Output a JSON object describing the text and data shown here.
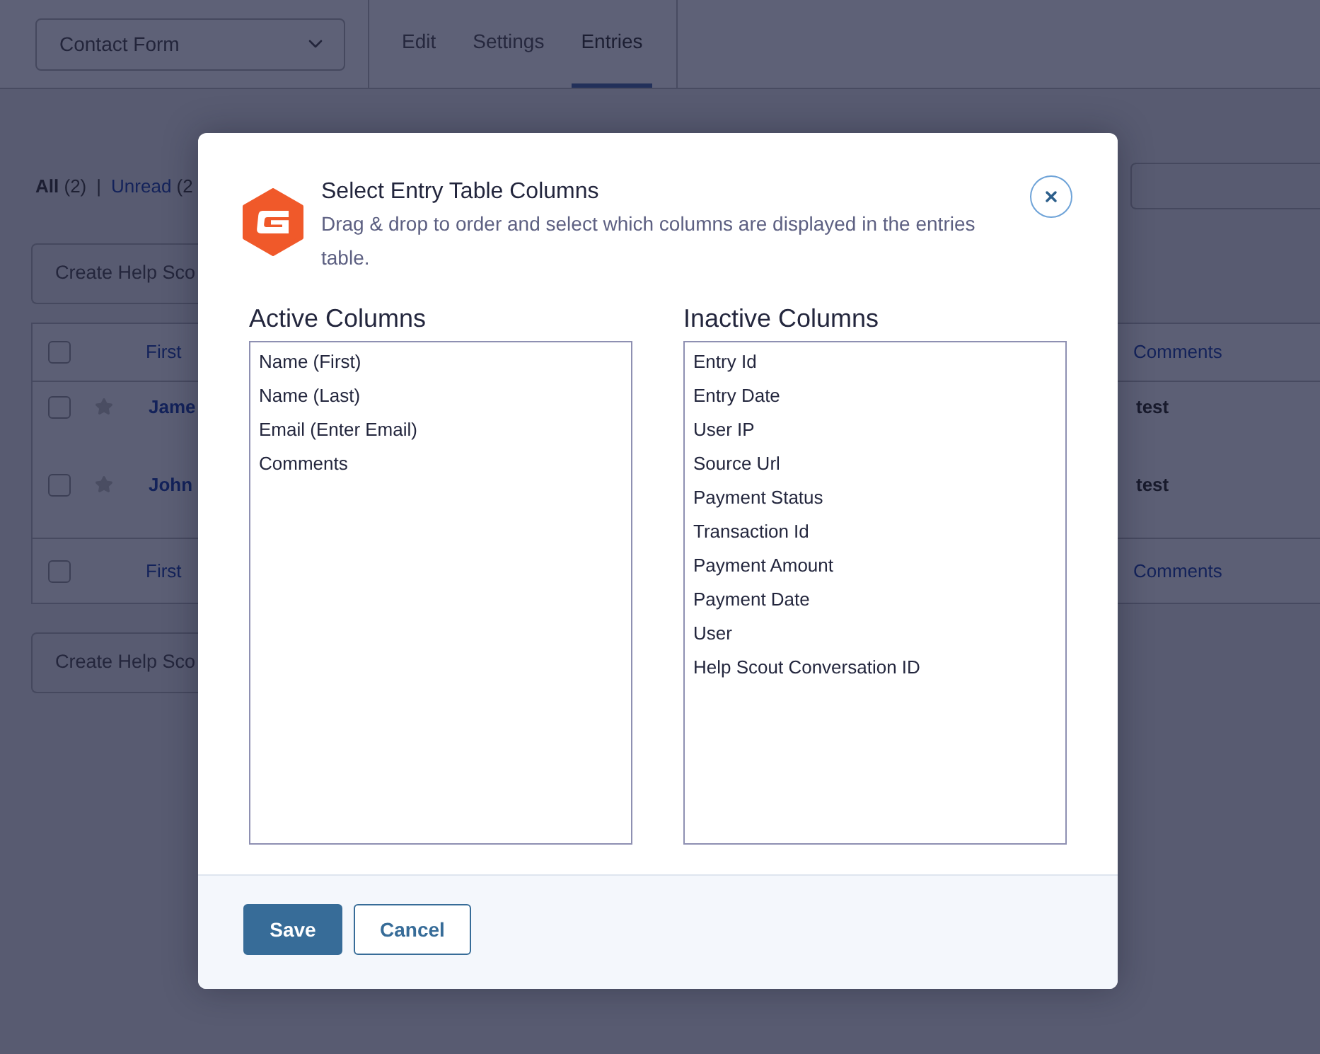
{
  "header": {
    "form_select": {
      "value": "Contact Form"
    },
    "tabs": [
      {
        "label": "Edit",
        "selected": false
      },
      {
        "label": "Settings",
        "selected": false
      },
      {
        "label": "Entries",
        "selected": true
      }
    ]
  },
  "filters": {
    "links": [
      {
        "label": "All",
        "count": "(2)",
        "selected": true
      },
      {
        "label": "Unread",
        "count": "(2",
        "selected": false
      }
    ],
    "separator": "|"
  },
  "bulk_actions_top": {
    "button": "Create Help Sco"
  },
  "table": {
    "header": {
      "checked": false,
      "columns": [
        "First",
        "Comments"
      ]
    },
    "rows": [
      {
        "checked": false,
        "starred": false,
        "first": "Jame",
        "comments": "test"
      },
      {
        "checked": false,
        "starred": false,
        "first": "John",
        "comments": "test"
      }
    ],
    "footer": {
      "checked": false,
      "columns": [
        "First",
        "Comments"
      ]
    }
  },
  "bulk_actions_bottom": {
    "button": "Create Help Sco"
  },
  "modal": {
    "title": "Select Entry Table Columns",
    "description": "Drag & drop to order and select which columns are displayed in the entries table.",
    "lists": [
      {
        "heading": "Active Columns",
        "items": [
          "Name (First)",
          "Name (Last)",
          "Email (Enter Email)",
          "Comments"
        ]
      },
      {
        "heading": "Inactive Columns",
        "items": [
          "Entry Id",
          "Entry Date",
          "User IP",
          "Source Url",
          "Payment Status",
          "Transaction Id",
          "Payment Amount",
          "Payment Date",
          "User",
          "Help Scout Conversation ID"
        ]
      }
    ],
    "buttons": [
      {
        "label": "Save",
        "kind": "primary"
      },
      {
        "label": "Cancel",
        "kind": "secondary"
      }
    ]
  }
}
